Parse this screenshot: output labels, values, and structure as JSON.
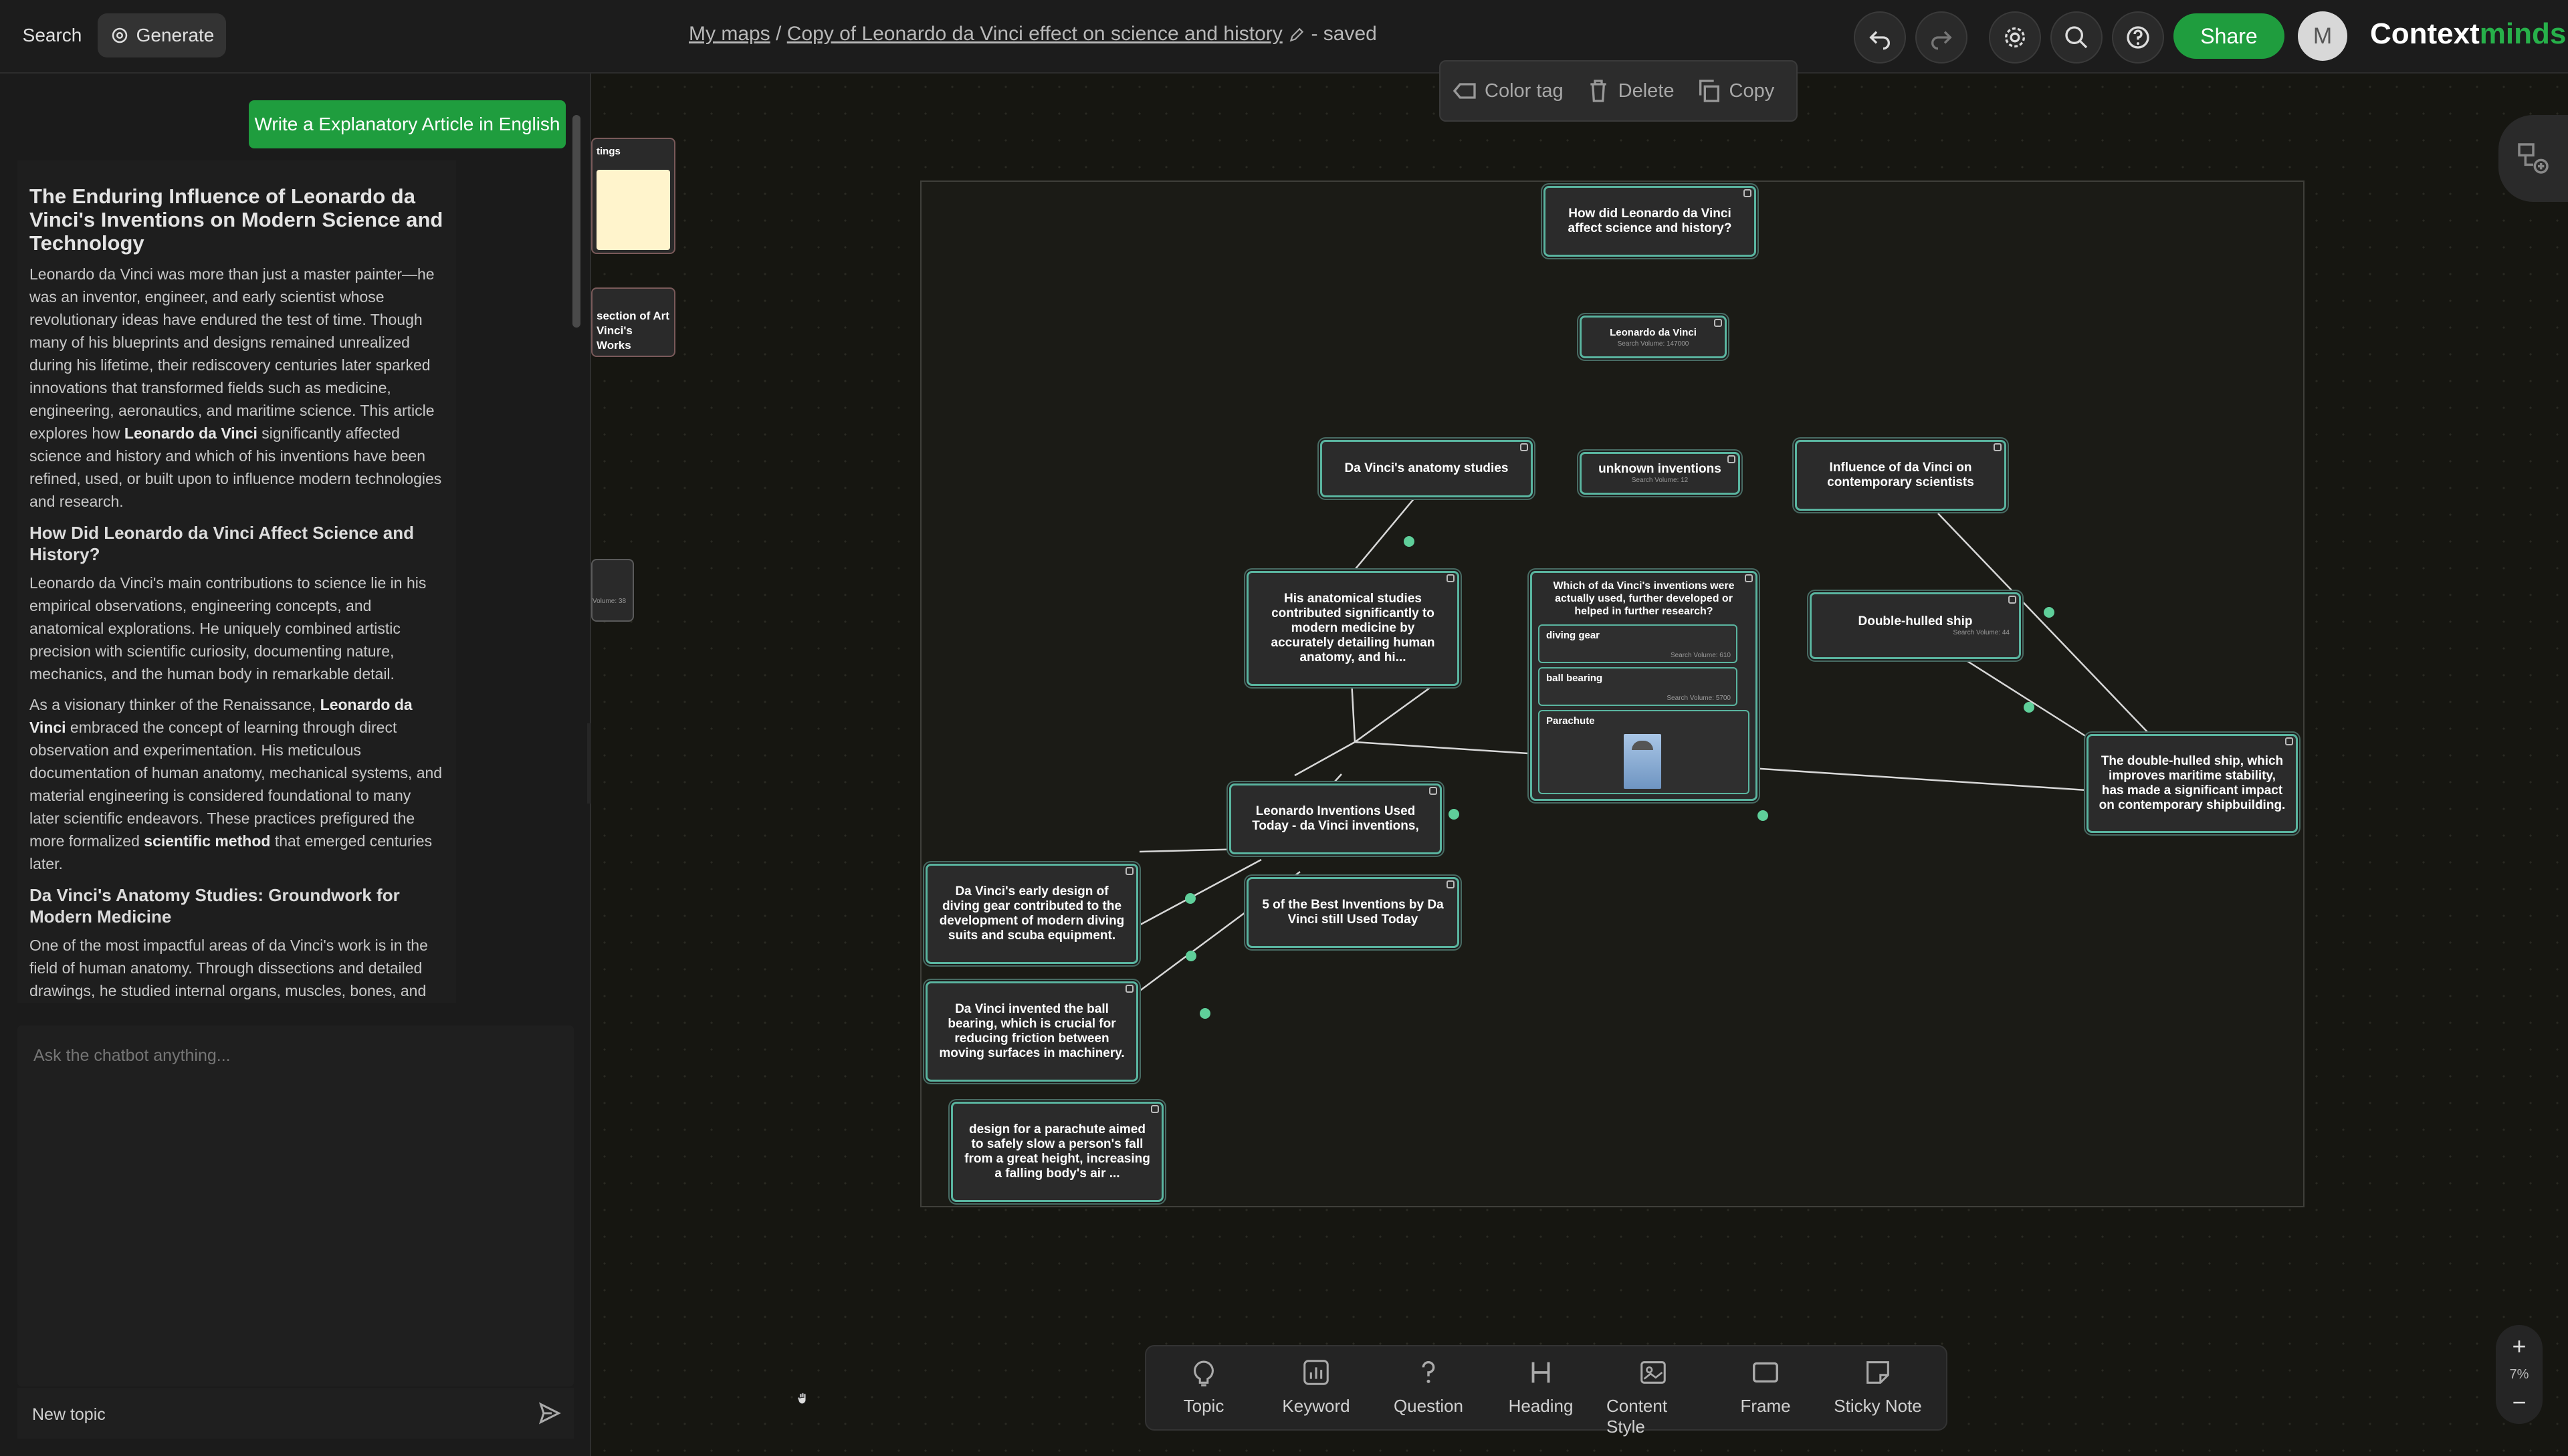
{
  "topbar": {
    "search_label": "Search",
    "generate_label": "Generate",
    "breadcrumb_root": "My maps",
    "breadcrumb_sep": "/",
    "map_title": "Copy of Leonardo da Vinci effect on science and history",
    "save_status": "- saved",
    "share_label": "Share",
    "avatar_initial": "M",
    "logo_main": "Context",
    "logo_accent": "minds"
  },
  "toolbar_float": {
    "color_tag": "Color tag",
    "delete": "Delete",
    "copy": "Copy"
  },
  "left_panel": {
    "write_button": "Write a Explanatory Article in English",
    "article": {
      "title": "The Enduring Influence of Leonardo da Vinci's Inventions on Modern Science and Technology",
      "p1_a": "Leonardo da Vinci was more than just a master painter—he was an inventor, engineer, and early scientist whose revolutionary ideas have endured the test of time. Though many of his blueprints and designs remained unrealized during his lifetime, their rediscovery centuries later sparked innovations that transformed fields such as medicine, engineering, aeronautics, and maritime science. This article explores how ",
      "p1_b": "Leonardo da Vinci",
      "p1_c": " significantly affected science and history and which of his inventions have been refined, used, or built upon to influence modern technologies and research.",
      "h2": "How Did Leonardo da Vinci Affect Science and History?",
      "p2": "Leonardo da Vinci's main contributions to science lie in his empirical observations, engineering concepts, and anatomical explorations. He uniquely combined artistic precision with scientific curiosity, documenting nature, mechanics, and the human body in remarkable detail.",
      "p3_a": "As a visionary thinker of the Renaissance, ",
      "p3_b": "Leonardo da Vinci",
      "p3_c": " embraced the concept of learning through direct observation and experimentation. His meticulous documentation of human anatomy, mechanical systems, and material engineering is considered foundational to many later scientific endeavors. These practices prefigured the more formalized ",
      "p3_d": "scientific method",
      "p3_e": " that emerged centuries later.",
      "h3": "Da Vinci's Anatomy Studies: Groundwork for Modern Medicine",
      "p4": "One of the most impactful areas of da Vinci's work is in the field of human anatomy. Through dissections and detailed drawings, he studied internal organs, muscles, bones, and even blood vessels. His anatomical sketches"
    },
    "chat_placeholder": "Ask the chatbot anything...",
    "new_topic": "New topic"
  },
  "canvas": {
    "offscreen": {
      "stub1": "tings",
      "stub2a": "section of Art",
      "stub2b": "Vinci's Works",
      "stub3": "Volume: 38"
    },
    "nodes": {
      "root": "How did Leonardo da Vinci affect science and history?",
      "ldv": "Leonardo da Vinci",
      "ldv_sv": "Search Volume: 147000",
      "anatomy": "Da Vinci's anatomy studies",
      "unknown": "unknown inventions",
      "unknown_sv": "Search Volume: 12",
      "influence": "Influence of da Vinci on contemporary scientists",
      "anat_desc": "His anatomical studies contributed significantly to modern medicine by accurately detailing human anatomy, and hi...",
      "which": "Which of da Vinci's inventions were actually used, further developed or helped in further research?",
      "diving": "diving gear",
      "diving_sv": "Search Volume: 610",
      "ball": "ball bearing",
      "ball_sv": "Search Volume: 5700",
      "parachute": "Parachute",
      "hulled": "Double-hulled ship",
      "hulled_sv": "Search Volume: 44",
      "hulled_desc": "The double-hulled ship, which improves maritime stability, has made a significant impact on contemporary shipbuilding.",
      "used_today": "Leonardo Inventions Used Today - da Vinci inventions,",
      "best5": "5 of the Best Inventions by Da Vinci still Used Today",
      "diving_desc": "Da Vinci's early design of diving gear contributed to the development of modern diving suits and scuba equipment.",
      "ball_desc": "Da Vinci invented the ball bearing, which is crucial for reducing friction between moving surfaces in machinery.",
      "para_desc": "design for a parachute aimed to safely slow a person's fall from a great height, increasing a falling body's air ..."
    }
  },
  "palette": {
    "topic": "Topic",
    "keyword": "Keyword",
    "question": "Question",
    "heading": "Heading",
    "content_style": "Content Style",
    "frame": "Frame",
    "sticky": "Sticky Note"
  },
  "zoom": {
    "plus": "+",
    "value": "7%",
    "minus": "−"
  },
  "colors": {
    "accent": "#1f9d3e",
    "node_border": "#5ab5a0",
    "background": "#161611"
  }
}
